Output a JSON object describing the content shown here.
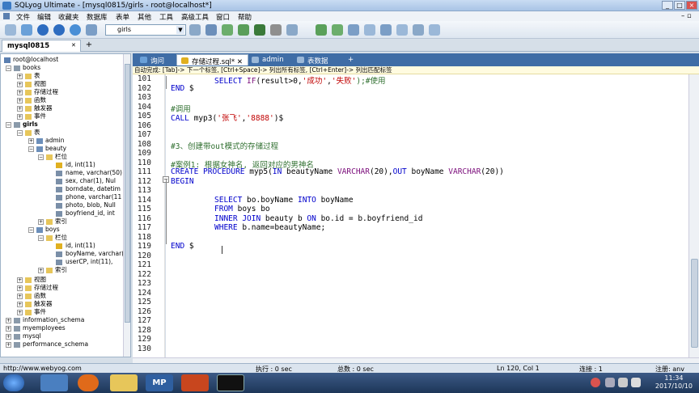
{
  "window": {
    "title": "SQLyog Ultimate - [mysql0815/girls - root@localhost*]"
  },
  "menu": [
    "文件",
    "编辑",
    "收藏夹",
    "数据库",
    "表单",
    "其他",
    "工具",
    "高级工具",
    "窗口",
    "帮助"
  ],
  "toolbar": {
    "db_selected": "girls"
  },
  "connection_tab": {
    "label": "mysql0815"
  },
  "tree": {
    "root": "root@localhost",
    "nodes": [
      {
        "label": "books"
      },
      {
        "label": "表"
      },
      {
        "label": "视图"
      },
      {
        "label": "存储过程"
      },
      {
        "label": "函数"
      },
      {
        "label": "触发器"
      },
      {
        "label": "事件"
      },
      {
        "label": "girls"
      },
      {
        "label": "表"
      },
      {
        "label": "admin"
      },
      {
        "label": "beauty"
      },
      {
        "label": "栏位"
      },
      {
        "label": "id, int(11)"
      },
      {
        "label": "name, varchar(50)"
      },
      {
        "label": "sex, char(1), Nul"
      },
      {
        "label": "borndate, datetim"
      },
      {
        "label": "phone, varchar(11"
      },
      {
        "label": "photo, blob, Null"
      },
      {
        "label": "boyfriend_id, int"
      },
      {
        "label": "索引"
      },
      {
        "label": "boys"
      },
      {
        "label": "栏位"
      },
      {
        "label": "id, int(11)"
      },
      {
        "label": "boyName, varchar("
      },
      {
        "label": "userCP, int(11),"
      },
      {
        "label": "索引"
      },
      {
        "label": "视图"
      },
      {
        "label": "存储过程"
      },
      {
        "label": "函数"
      },
      {
        "label": "触发器"
      },
      {
        "label": "事件"
      },
      {
        "label": "information_schema"
      },
      {
        "label": "myemployees"
      },
      {
        "label": "mysql"
      },
      {
        "label": "performance_schema"
      }
    ]
  },
  "editor_tabs": [
    "询问",
    "存储过程.sql*",
    "admin",
    "表数据"
  ],
  "autocomplete_hint": "自动完成: [Tab]-> 下一个标签, [Ctrl+Space]-> 列出所有标签, [Ctrl+Enter]-> 列出匹配标签",
  "lines": [
    "101",
    "102",
    "103",
    "104",
    "105",
    "106",
    "107",
    "108",
    "109",
    "110",
    "111",
    "112",
    "113",
    "114",
    "115",
    "116",
    "117",
    "118",
    "119",
    "120",
    "121",
    "122",
    "123",
    "124",
    "125",
    "126",
    "127",
    "128",
    "129",
    "130"
  ],
  "code": {
    "l101a": "SELECT ",
    "l101b": "IF",
    "l101c": "(result>0,",
    "l101d": "'成功'",
    "l101e": ",",
    "l101f": "'失败'",
    "l101g": ");#使用",
    "l102a": "END",
    "l102b": " $",
    "l104": "#调用",
    "l105a": "CALL",
    "l105b": " myp3(",
    "l105c": "'张飞'",
    "l105d": ",",
    "l105e": "'8888'",
    "l105f": ")$",
    "l108": "#3、创建带out模式的存储过程",
    "l110": "#案例1: 根据女神名, 返回对应的男神名",
    "l111a": "CREATE PROCEDURE",
    "l111b": " myp5(",
    "l111c": "IN",
    "l111d": " beautyName ",
    "l111e": "VARCHAR",
    "l111f": "(20),",
    "l111g": "OUT",
    "l111h": " boyName ",
    "l111i": "VARCHAR",
    "l111j": "(20))",
    "l112": "BEGIN",
    "l114a": "SELECT",
    "l114b": " bo.boyName ",
    "l114c": "INTO",
    "l114d": " boyName",
    "l115a": "FROM",
    "l115b": " boys bo",
    "l116a": "INNER JOIN",
    "l116b": " beauty b ",
    "l116c": "ON",
    "l116d": " bo.id = b.boyfriend_id",
    "l117a": "WHERE",
    "l117b": " b.name=beautyName;",
    "l119a": "END",
    "l119b": " $"
  },
  "status": {
    "url": "http://www.webyog.com",
    "exec": "执行 : 0 sec",
    "total": "总数 : 0 sec",
    "pos": "Ln 120, Col 1",
    "conn": "连接 : 1",
    "reg": "注册: anv"
  },
  "clock": {
    "time": "11:34",
    "date": "2017/10/10"
  }
}
